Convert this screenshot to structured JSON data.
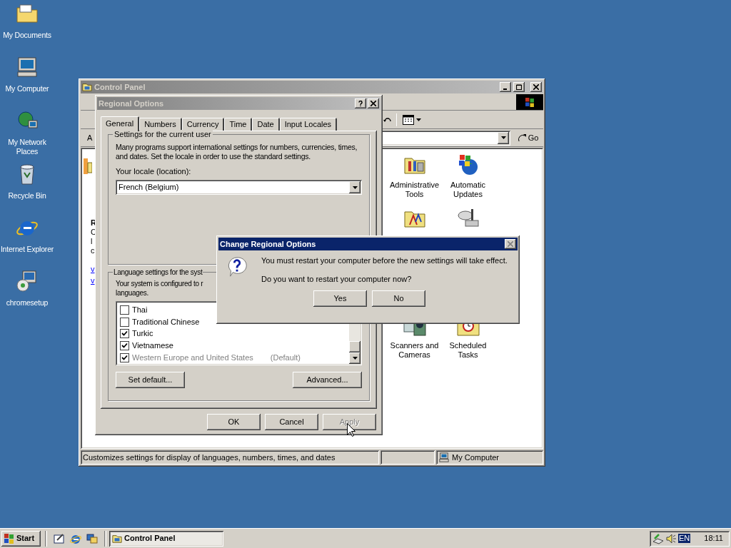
{
  "desktop_icons": [
    {
      "label": "My Documents",
      "kind": "folder"
    },
    {
      "label": "My Computer",
      "kind": "computer"
    },
    {
      "label": "My Network Places",
      "kind": "network"
    },
    {
      "label": "Recycle Bin",
      "kind": "bin"
    },
    {
      "label": "Internet Explorer",
      "kind": "browser"
    },
    {
      "label": "chromesetup",
      "kind": "setup"
    }
  ],
  "control_panel": {
    "title": "Control Panel",
    "address_label": "A",
    "go_button": "Go",
    "left_pane": {
      "texts": [
        "R",
        "C",
        "l",
        "c"
      ],
      "links": [
        "v",
        "v"
      ]
    },
    "items": [
      {
        "label": "Administrative Tools",
        "kind": "admin"
      },
      {
        "label": "Automatic Updates",
        "kind": "updates"
      },
      {
        "kind": "fonts"
      },
      {
        "kind": "game"
      },
      {
        "label": "Scanners and Cameras",
        "kind": "scanner"
      },
      {
        "label": "Scheduled Tasks",
        "kind": "tasks"
      }
    ],
    "status_bar": {
      "text": "Customizes settings for display of languages, numbers, times, and dates",
      "zone": "My Computer"
    }
  },
  "regional_options": {
    "title": "Regional Options",
    "tabs": [
      {
        "label": "General",
        "selected": true
      },
      {
        "label": "Numbers",
        "selected": false
      },
      {
        "label": "Currency",
        "selected": false
      },
      {
        "label": "Time",
        "selected": false
      },
      {
        "label": "Date",
        "selected": false
      },
      {
        "label": "Input Locales",
        "selected": false
      }
    ],
    "user_group": {
      "title": "Settings for the current user",
      "description": "Many programs support international settings for numbers, currencies, times, and dates. Set the locale in order to use the standard settings.",
      "locale_label": "Your locale (location):",
      "locale_value": "French (Belgium)"
    },
    "system_group": {
      "title": "Language settings for the syst",
      "description": [
        "Your system is configured to r",
        "languages."
      ]
    },
    "languages": [
      {
        "label": "Thai",
        "checked": false,
        "disabled": false
      },
      {
        "label": "Traditional Chinese",
        "checked": false,
        "disabled": false
      },
      {
        "label": "Turkic",
        "checked": true,
        "disabled": false
      },
      {
        "label": "Vietnamese",
        "checked": true,
        "disabled": false
      },
      {
        "label": "Western Europe and United States",
        "note": "(Default)",
        "checked": true,
        "disabled": true
      }
    ],
    "group_buttons": [
      "Set default...",
      "Advanced..."
    ],
    "footer_buttons": [
      {
        "label": "OK",
        "disabled": false
      },
      {
        "label": "Cancel",
        "disabled": false
      },
      {
        "label": "Apply",
        "disabled": true
      }
    ]
  },
  "message_box": {
    "title": "Change Regional Options",
    "close_disabled": true,
    "lines": [
      "You must restart your computer before the new settings will take effect.",
      "Do you want to restart your computer now?"
    ],
    "buttons": [
      "Yes",
      "No"
    ]
  },
  "taskbar": {
    "start": "Start",
    "tasks": [
      {
        "label": "Control Panel",
        "selected": true
      }
    ],
    "language": "EN",
    "clock": "18:11"
  }
}
